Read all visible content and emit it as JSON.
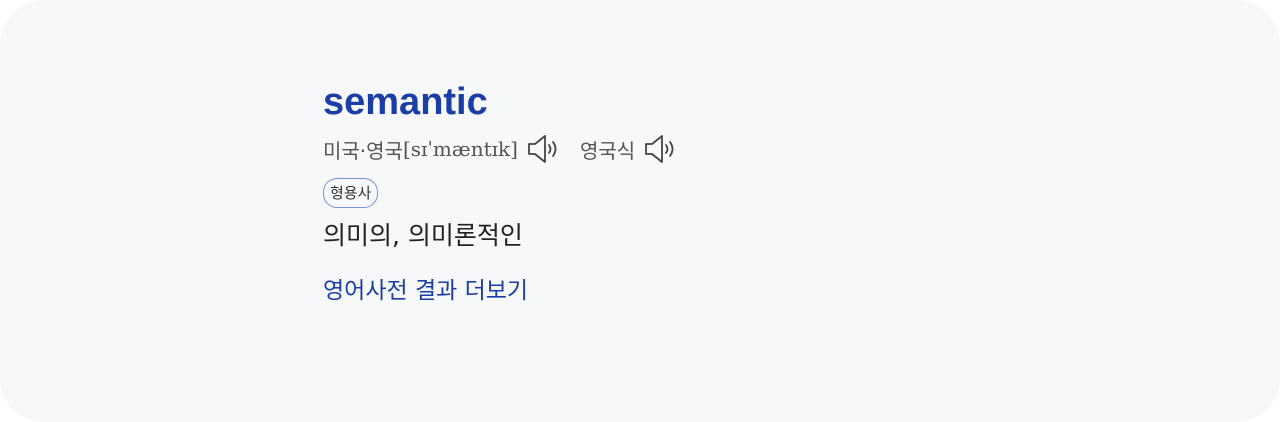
{
  "entry": {
    "word": "semantic",
    "pronunciations": [
      {
        "label": "미국·영국",
        "ipa": "[sɪˈmæntɪk]",
        "icon": "speaker-icon"
      },
      {
        "label": "영국식",
        "icon": "speaker-icon"
      }
    ],
    "part_of_speech": "형용사",
    "meaning": "의미의, 의미론적인",
    "more_link": "영어사전 결과 더보기"
  },
  "colors": {
    "accent": "#1a3ea6",
    "card_background": "#f7f8fa",
    "badge_border": "#7b93d6"
  }
}
